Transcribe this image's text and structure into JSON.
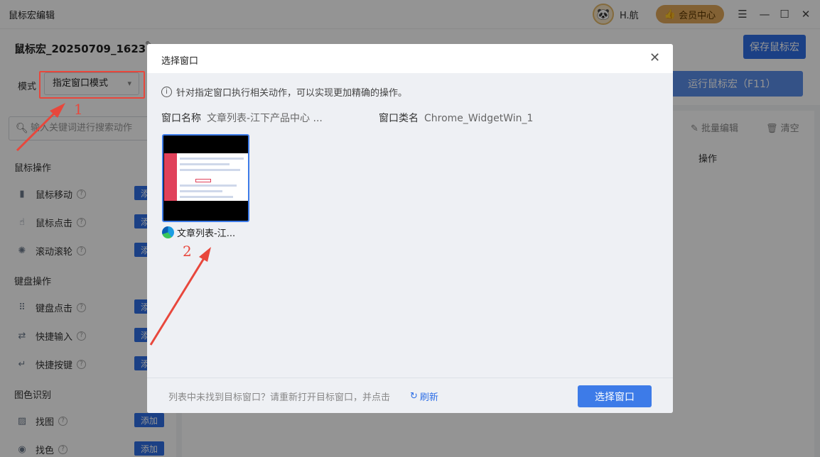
{
  "app": {
    "title": "鼠标宏编辑",
    "user_name": "H.航",
    "vip_label": "会员中心",
    "controls": [
      "menu-icon",
      "minimize-icon",
      "maximize-icon",
      "close-icon"
    ]
  },
  "macro": {
    "name": "鼠标宏_20250709_1623",
    "save_label": "保存鼠标宏",
    "run_label": "运行鼠标宏（F11）"
  },
  "mode": {
    "label": "模式",
    "value": "指定窗口模式"
  },
  "sidebar": {
    "search_placeholder": "输入关键词进行搜索动作",
    "sections": [
      {
        "title": "鼠标操作",
        "items": [
          {
            "label": "鼠标移动",
            "add": "添加",
            "icon": "mouse-icon"
          },
          {
            "label": "鼠标点击",
            "add": "添加",
            "icon": "mouse-click-icon"
          },
          {
            "label": "滚动滚轮",
            "add": "添加",
            "icon": "scroll-wheel-icon"
          }
        ]
      },
      {
        "title": "键盘操作",
        "items": [
          {
            "label": "键盘点击",
            "add": "添加",
            "icon": "keyboard-icon"
          },
          {
            "label": "快捷输入",
            "add": "添加",
            "icon": "quick-input-icon"
          },
          {
            "label": "快捷按键",
            "add": "添加",
            "icon": "quick-key-icon"
          }
        ]
      },
      {
        "title": "图色识别",
        "items": [
          {
            "label": "找图",
            "add": "添加",
            "icon": "image-icon"
          },
          {
            "label": "找色",
            "add": "添加",
            "icon": "color-icon"
          }
        ]
      }
    ]
  },
  "main": {
    "batch_edit": "批量编辑",
    "clear": "清空",
    "op_header": "操作"
  },
  "dialog": {
    "title": "选择窗口",
    "tip": "针对指定窗口执行相关动作，可以实现更加精确的操作。",
    "window_name_key": "窗口名称",
    "window_name_value": "文章列表-江下产品中心 ...",
    "window_class_key": "窗口类名",
    "window_class_value": "Chrome_WidgetWin_1",
    "windows": [
      {
        "label": "文章列表-江...",
        "icon": "edge-browser-icon"
      }
    ],
    "footer_text": "列表中未找到目标窗口？请重新打开目标窗口，并点击",
    "refresh_label": "刷新",
    "select_label": "选择窗口"
  },
  "annotations": {
    "one": "1",
    "two": "2",
    "color": "#e8473c"
  },
  "colors": {
    "primary": "#2f6fe6",
    "overlay": "rgba(0,0,0,0.42)"
  }
}
